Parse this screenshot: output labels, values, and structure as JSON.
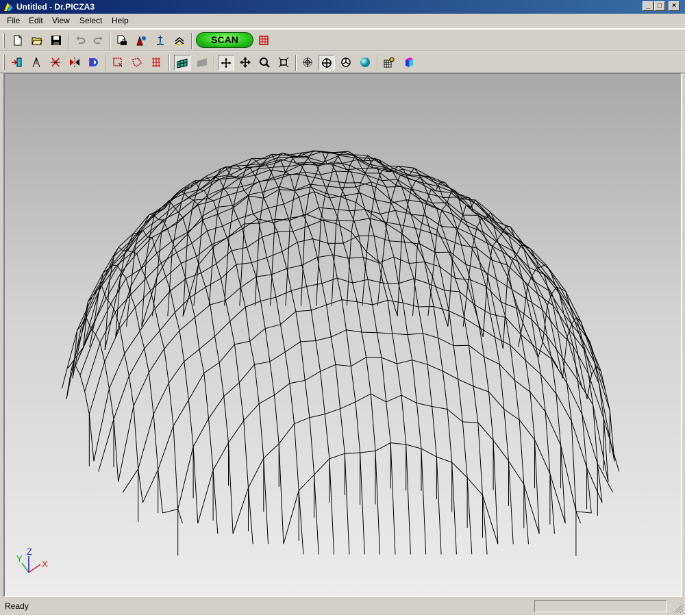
{
  "window": {
    "title": "Untitled - Dr.PICZA3",
    "controls": {
      "minimize": "_",
      "maximize": "□",
      "close": "×"
    }
  },
  "menu": [
    "File",
    "Edit",
    "View",
    "Select",
    "Help"
  ],
  "toolbar_main": {
    "buttons": [
      "new-file-icon",
      "open-folder-icon",
      "save-disk-icon",
      "undo-icon",
      "redo-icon",
      "print-preview-icon",
      "color-settings-icon",
      "probe-settings-icon",
      "layers-icon"
    ],
    "scan_label": "SCAN",
    "after_scan": "scan-area-icon"
  },
  "toolbar_view": {
    "buttons": [
      "fit-x-icon",
      "fit-y-icon",
      "flip-icon",
      "mirror-icon",
      "half-icon",
      "select-rect-icon",
      "select-poly-icon",
      "select-free-icon",
      "wireframe-icon",
      "shaded-icon",
      "rotate-icon",
      "pan-icon",
      "zoom-icon",
      "zoom-fit-icon",
      "view-front-icon",
      "view-top-icon",
      "view-side-icon",
      "view-sphere-icon",
      "export-icon",
      "cube-icon"
    ],
    "pressed": [
      "wireframe-icon",
      "rotate-icon",
      "view-top-icon"
    ]
  },
  "viewport": {
    "axis_labels": {
      "x": "X",
      "y": "Y",
      "z": "Z"
    },
    "mesh_color": "#000000"
  },
  "status": {
    "text": "Ready"
  }
}
